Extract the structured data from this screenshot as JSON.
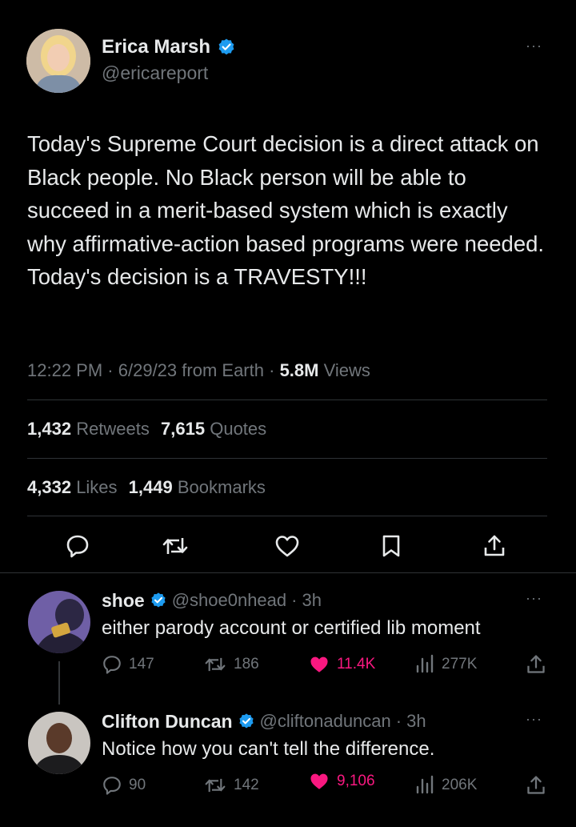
{
  "main_tweet": {
    "author_name": "Erica Marsh",
    "author_handle": "@ericareport",
    "text": "Today's Supreme Court decision is a direct attack on Black people. No Black person will be able to succeed in a merit-based system which is exactly why affirmative-action based programs were needed. Today's decision is a TRAVESTY!!!",
    "time": "12:22 PM",
    "date": "6/29/23",
    "source": "from Earth",
    "views_count": "5.8M",
    "views_label": "Views",
    "retweets_count": "1,432",
    "retweets_label": "Retweets",
    "quotes_count": "7,615",
    "quotes_label": "Quotes",
    "likes_count": "4,332",
    "likes_label": "Likes",
    "bookmarks_count": "1,449",
    "bookmarks_label": "Bookmarks",
    "more_label": "···"
  },
  "replies": [
    {
      "name": "shoe",
      "handle": "@shoe0nhead",
      "age": "3h",
      "text": "either parody account or certified lib moment",
      "replies": "147",
      "retweets": "186",
      "likes": "11.4K",
      "views": "277K"
    },
    {
      "name": "Clifton Duncan",
      "handle": "@cliftonaduncan",
      "age": "3h",
      "text": "Notice how you can't tell the difference.",
      "replies": "90",
      "retweets": "142",
      "likes": "9,106",
      "views": "206K"
    }
  ],
  "colors": {
    "background": "#000000",
    "text": "#e7e9ea",
    "muted": "#71767b",
    "verified": "#1d9bf0",
    "like": "#f91880",
    "divider": "#2f3336"
  }
}
